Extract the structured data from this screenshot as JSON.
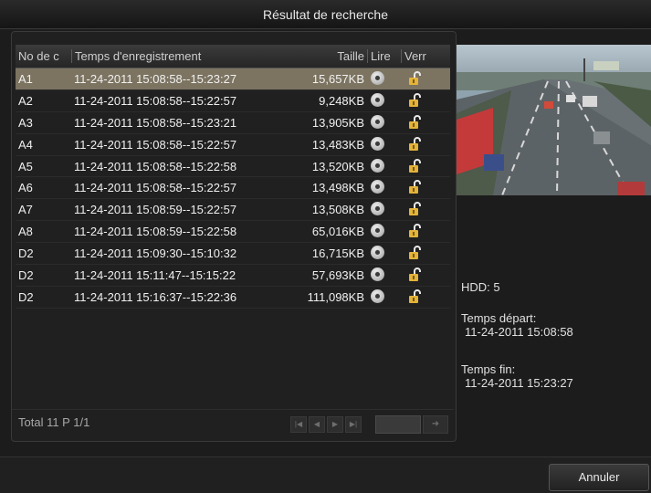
{
  "window": {
    "title": "Résultat de recherche"
  },
  "table": {
    "headers": {
      "no": "No de c",
      "time": "Temps d'enregistrement",
      "size": "Taille",
      "play": "Lire",
      "lock": "Verr"
    },
    "rows": [
      {
        "no": "A1",
        "time": "11-24-2011 15:08:58--15:23:27",
        "size": "15,657KB",
        "selected": true
      },
      {
        "no": "A2",
        "time": "11-24-2011 15:08:58--15:22:57",
        "size": "9,248KB"
      },
      {
        "no": "A3",
        "time": "11-24-2011 15:08:58--15:23:21",
        "size": "13,905KB"
      },
      {
        "no": "A4",
        "time": "11-24-2011 15:08:58--15:22:57",
        "size": "13,483KB"
      },
      {
        "no": "A5",
        "time": "11-24-2011 15:08:58--15:22:58",
        "size": "13,520KB"
      },
      {
        "no": "A6",
        "time": "11-24-2011 15:08:58--15:22:57",
        "size": "13,498KB"
      },
      {
        "no": "A7",
        "time": "11-24-2011 15:08:59--15:22:57",
        "size": "13,508KB"
      },
      {
        "no": "A8",
        "time": "11-24-2011 15:08:59--15:22:58",
        "size": "65,016KB"
      },
      {
        "no": "D2",
        "time": "11-24-2011 15:09:30--15:10:32",
        "size": "16,715KB"
      },
      {
        "no": "D2",
        "time": "11-24-2011 15:11:47--15:15:22",
        "size": "57,693KB"
      },
      {
        "no": "D2",
        "time": "11-24-2011 15:16:37--15:22:36",
        "size": "111,098KB"
      }
    ]
  },
  "footer": {
    "total": "Total 11 P 1/1"
  },
  "details": {
    "hdd": "HDD: 5",
    "start_label": "Temps départ:",
    "start_value": "11-24-2011 15:08:58",
    "end_label": "Temps fin:",
    "end_value": "11-24-2011 15:23:27"
  },
  "buttons": {
    "cancel": "Annuler"
  },
  "icons": {
    "play": "play-icon",
    "lock": "lock-icon",
    "first": "first-page-icon",
    "prev": "prev-page-icon",
    "next": "next-page-icon",
    "last": "last-page-icon",
    "go": "go-arrow-icon"
  },
  "colors": {
    "selected_row": "#7c7461",
    "background": "#1c1c1c"
  }
}
